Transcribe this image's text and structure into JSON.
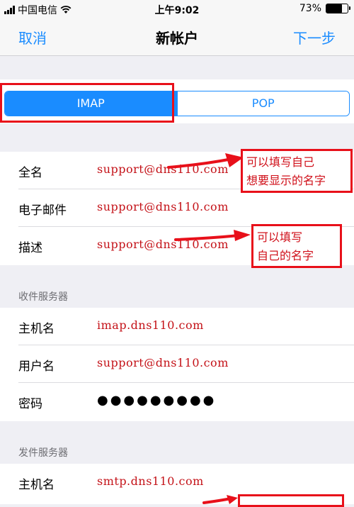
{
  "status_bar": {
    "carrier": "中国电信",
    "time": "上午9:02",
    "battery_percent": "73%",
    "battery_level": 0.73
  },
  "nav": {
    "cancel": "取消",
    "title": "新帐户",
    "next": "下一步"
  },
  "segmented": {
    "options": [
      "IMAP",
      "POP"
    ],
    "selected": "IMAP"
  },
  "account": {
    "rows": [
      {
        "label": "全名",
        "value": "support@dns110.com"
      },
      {
        "label": "电子邮件",
        "value": "support@dns110.com"
      },
      {
        "label": "描述",
        "value": "support@dns110.com"
      }
    ]
  },
  "incoming": {
    "header": "收件服务器",
    "rows": [
      {
        "label": "主机名",
        "value": "imap.dns110.com"
      },
      {
        "label": "用户名",
        "value": "support@dns110.com"
      },
      {
        "label": "密码",
        "value": "●●●●●●●●●"
      }
    ]
  },
  "outgoing": {
    "header": "发件服务器",
    "rows": [
      {
        "label": "主机名",
        "value": "smtp.dns110.com"
      }
    ]
  },
  "annotations": {
    "fullname_note": [
      "可以填写自己",
      "想要显示的名字"
    ],
    "description_note": [
      "可以填写",
      "自己的名字"
    ]
  },
  "colors": {
    "accent": "#1a8cff",
    "annotation_red": "#e8101a",
    "value_red": "#c41218"
  }
}
